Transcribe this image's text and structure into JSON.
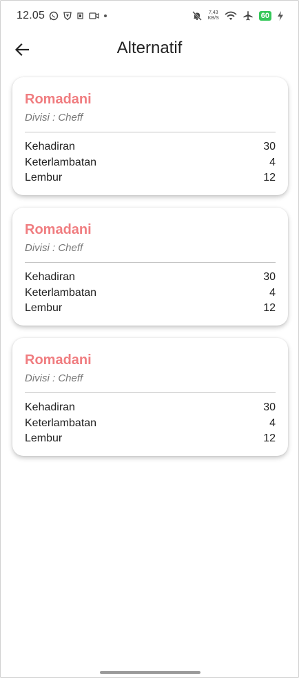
{
  "status_bar": {
    "time": "12.05",
    "net_speed_value": "7,43",
    "net_speed_unit": "KB/S",
    "battery": "60"
  },
  "app_bar": {
    "title": "Alternatif"
  },
  "cards": [
    {
      "name": "Romadani",
      "division": "Divisi : Cheff",
      "stats": [
        {
          "label": "Kehadiran",
          "value": "30"
        },
        {
          "label": "Keterlambatan",
          "value": "4"
        },
        {
          "label": "Lembur",
          "value": "12"
        }
      ]
    },
    {
      "name": "Romadani",
      "division": "Divisi : Cheff",
      "stats": [
        {
          "label": "Kehadiran",
          "value": "30"
        },
        {
          "label": "Keterlambatan",
          "value": "4"
        },
        {
          "label": "Lembur",
          "value": "12"
        }
      ]
    },
    {
      "name": "Romadani",
      "division": "Divisi : Cheff",
      "stats": [
        {
          "label": "Kehadiran",
          "value": "30"
        },
        {
          "label": "Keterlambatan",
          "value": "4"
        },
        {
          "label": "Lembur",
          "value": "12"
        }
      ]
    }
  ],
  "colors": {
    "name_accent": "#f07d80",
    "battery": "#34c759"
  }
}
